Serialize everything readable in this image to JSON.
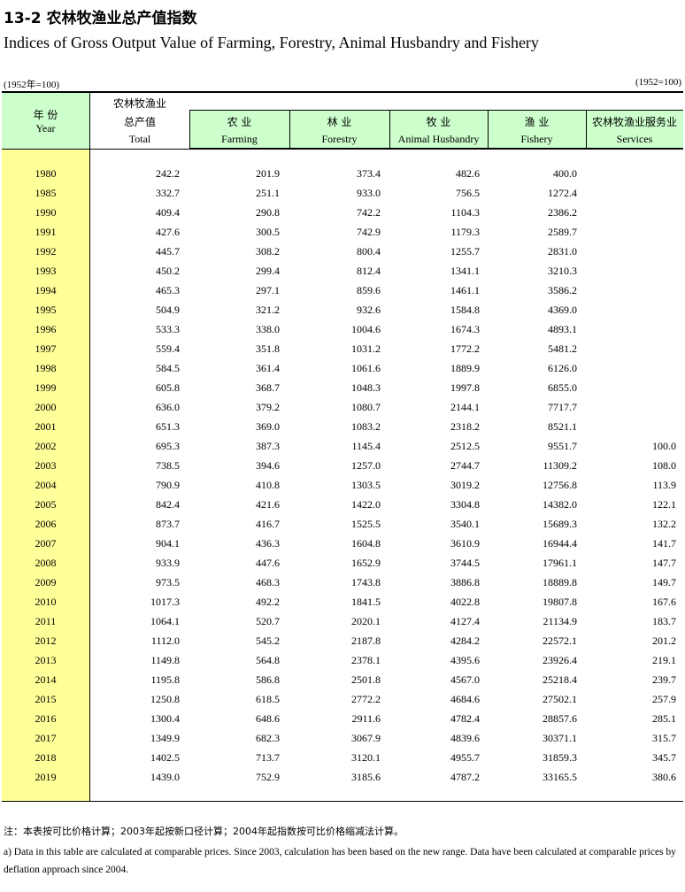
{
  "title": {
    "cn": "13-2  农林牧渔业总产值指数",
    "en": "Indices of Gross Output Value of Farming, Forestry, Animal Husbandry and Fishery"
  },
  "base_note": {
    "left": "(1952年=100)",
    "right": "(1952=100)"
  },
  "header": {
    "year_cn": "年  份",
    "year_en": "Year",
    "group_cn_line1": "农林牧渔业",
    "total_cn": "总产值",
    "total_en": "Total",
    "farming_cn": "农  业",
    "farming_en": "Farming",
    "forestry_cn": "林  业",
    "forestry_en": "Forestry",
    "animal_cn": "牧  业",
    "animal_en": "Animal Husbandry",
    "fishery_cn": "渔  业",
    "fishery_en": "Fishery",
    "services_cn": "农林牧渔业服务业",
    "services_en": "Services"
  },
  "rows": [
    {
      "year": "1980",
      "total": "242.2",
      "farming": "201.9",
      "forestry": "373.4",
      "animal": "482.6",
      "fishery": "400.0",
      "services": ""
    },
    {
      "year": "1985",
      "total": "332.7",
      "farming": "251.1",
      "forestry": "933.0",
      "animal": "756.5",
      "fishery": "1272.4",
      "services": ""
    },
    {
      "year": "1990",
      "total": "409.4",
      "farming": "290.8",
      "forestry": "742.2",
      "animal": "1104.3",
      "fishery": "2386.2",
      "services": ""
    },
    {
      "year": "1991",
      "total": "427.6",
      "farming": "300.5",
      "forestry": "742.9",
      "animal": "1179.3",
      "fishery": "2589.7",
      "services": ""
    },
    {
      "year": "1992",
      "total": "445.7",
      "farming": "308.2",
      "forestry": "800.4",
      "animal": "1255.7",
      "fishery": "2831.0",
      "services": ""
    },
    {
      "year": "1993",
      "total": "450.2",
      "farming": "299.4",
      "forestry": "812.4",
      "animal": "1341.1",
      "fishery": "3210.3",
      "services": ""
    },
    {
      "year": "1994",
      "total": "465.3",
      "farming": "297.1",
      "forestry": "859.6",
      "animal": "1461.1",
      "fishery": "3586.2",
      "services": ""
    },
    {
      "year": "1995",
      "total": "504.9",
      "farming": "321.2",
      "forestry": "932.6",
      "animal": "1584.8",
      "fishery": "4369.0",
      "services": ""
    },
    {
      "year": "1996",
      "total": "533.3",
      "farming": "338.0",
      "forestry": "1004.6",
      "animal": "1674.3",
      "fishery": "4893.1",
      "services": ""
    },
    {
      "year": "1997",
      "total": "559.4",
      "farming": "351.8",
      "forestry": "1031.2",
      "animal": "1772.2",
      "fishery": "5481.2",
      "services": ""
    },
    {
      "year": "1998",
      "total": "584.5",
      "farming": "361.4",
      "forestry": "1061.6",
      "animal": "1889.9",
      "fishery": "6126.0",
      "services": ""
    },
    {
      "year": "1999",
      "total": "605.8",
      "farming": "368.7",
      "forestry": "1048.3",
      "animal": "1997.8",
      "fishery": "6855.0",
      "services": ""
    },
    {
      "year": "2000",
      "total": "636.0",
      "farming": "379.2",
      "forestry": "1080.7",
      "animal": "2144.1",
      "fishery": "7717.7",
      "services": ""
    },
    {
      "year": "2001",
      "total": "651.3",
      "farming": "369.0",
      "forestry": "1083.2",
      "animal": "2318.2",
      "fishery": "8521.1",
      "services": ""
    },
    {
      "year": "2002",
      "total": "695.3",
      "farming": "387.3",
      "forestry": "1145.4",
      "animal": "2512.5",
      "fishery": "9551.7",
      "services": "100.0"
    },
    {
      "year": "2003",
      "total": "738.5",
      "farming": "394.6",
      "forestry": "1257.0",
      "animal": "2744.7",
      "fishery": "11309.2",
      "services": "108.0"
    },
    {
      "year": "2004",
      "total": "790.9",
      "farming": "410.8",
      "forestry": "1303.5",
      "animal": "3019.2",
      "fishery": "12756.8",
      "services": "113.9"
    },
    {
      "year": "2005",
      "total": "842.4",
      "farming": "421.6",
      "forestry": "1422.0",
      "animal": "3304.8",
      "fishery": "14382.0",
      "services": "122.1"
    },
    {
      "year": "2006",
      "total": "873.7",
      "farming": "416.7",
      "forestry": "1525.5",
      "animal": "3540.1",
      "fishery": "15689.3",
      "services": "132.2"
    },
    {
      "year": "2007",
      "total": "904.1",
      "farming": "436.3",
      "forestry": "1604.8",
      "animal": "3610.9",
      "fishery": "16944.4",
      "services": "141.7"
    },
    {
      "year": "2008",
      "total": "933.9",
      "farming": "447.6",
      "forestry": "1652.9",
      "animal": "3744.5",
      "fishery": "17961.1",
      "services": "147.7"
    },
    {
      "year": "2009",
      "total": "973.5",
      "farming": "468.3",
      "forestry": "1743.8",
      "animal": "3886.8",
      "fishery": "18889.8",
      "services": "149.7"
    },
    {
      "year": "2010",
      "total": "1017.3",
      "farming": "492.2",
      "forestry": "1841.5",
      "animal": "4022.8",
      "fishery": "19807.8",
      "services": "167.6"
    },
    {
      "year": "2011",
      "total": "1064.1",
      "farming": "520.7",
      "forestry": "2020.1",
      "animal": "4127.4",
      "fishery": "21134.9",
      "services": "183.7"
    },
    {
      "year": "2012",
      "total": "1112.0",
      "farming": "545.2",
      "forestry": "2187.8",
      "animal": "4284.2",
      "fishery": "22572.1",
      "services": "201.2"
    },
    {
      "year": "2013",
      "total": "1149.8",
      "farming": "564.8",
      "forestry": "2378.1",
      "animal": "4395.6",
      "fishery": "23926.4",
      "services": "219.1"
    },
    {
      "year": "2014",
      "total": "1195.8",
      "farming": "586.8",
      "forestry": "2501.8",
      "animal": "4567.0",
      "fishery": "25218.4",
      "services": "239.7"
    },
    {
      "year": "2015",
      "total": "1250.8",
      "farming": "618.5",
      "forestry": "2772.2",
      "animal": "4684.6",
      "fishery": "27502.1",
      "services": "257.9"
    },
    {
      "year": "2016",
      "total": "1300.4",
      "farming": "648.6",
      "forestry": "2911.6",
      "animal": "4782.4",
      "fishery": "28857.6",
      "services": "285.1"
    },
    {
      "year": "2017",
      "total": "1349.9",
      "farming": "682.3",
      "forestry": "3067.9",
      "animal": "4839.6",
      "fishery": "30371.1",
      "services": "315.7"
    },
    {
      "year": "2018",
      "total": "1402.5",
      "farming": "713.7",
      "forestry": "3120.1",
      "animal": "4955.7",
      "fishery": "31859.3",
      "services": "345.7"
    },
    {
      "year": "2019",
      "total": "1439.0",
      "farming": "752.9",
      "forestry": "3185.6",
      "animal": "4787.2",
      "fishery": "33165.5",
      "services": "380.6"
    }
  ],
  "footnote": {
    "cn": "注：本表按可比价格计算；2003年起按新口径计算；2004年起指数按可比价格缩减法计算。",
    "en": "a) Data in this table are calculated at comparable prices. Since 2003, calculation has been based on the new range. Data have been calculated at comparable prices by deflation approach since 2004."
  },
  "colors": {
    "year_column_bg": "#ffff99",
    "header_bg": "#ccffcc"
  }
}
